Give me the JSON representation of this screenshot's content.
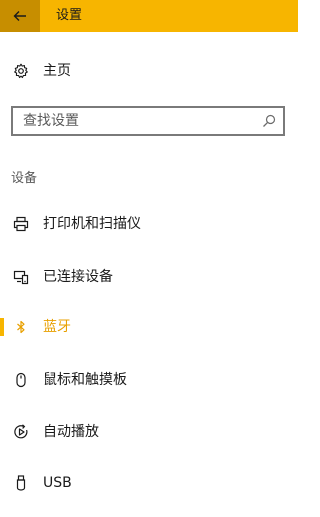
{
  "titlebar": {
    "title": "设置",
    "accent_color": "#f7b500",
    "back_icon": "back-arrow-icon"
  },
  "home": {
    "label": "主页",
    "icon": "gear-icon"
  },
  "search": {
    "placeholder": "查找设置",
    "icon": "search-icon"
  },
  "section": {
    "title": "设备"
  },
  "nav_items": [
    {
      "label": "打印机和扫描仪",
      "icon": "printer-icon"
    },
    {
      "label": "已连接设备",
      "icon": "connected-devices-icon"
    },
    {
      "label": "蓝牙",
      "icon": "bluetooth-icon",
      "selected": true
    },
    {
      "label": "鼠标和触摸板",
      "icon": "mouse-icon"
    },
    {
      "label": "自动播放",
      "icon": "autoplay-icon"
    },
    {
      "label": "USB",
      "icon": "usb-icon"
    }
  ]
}
